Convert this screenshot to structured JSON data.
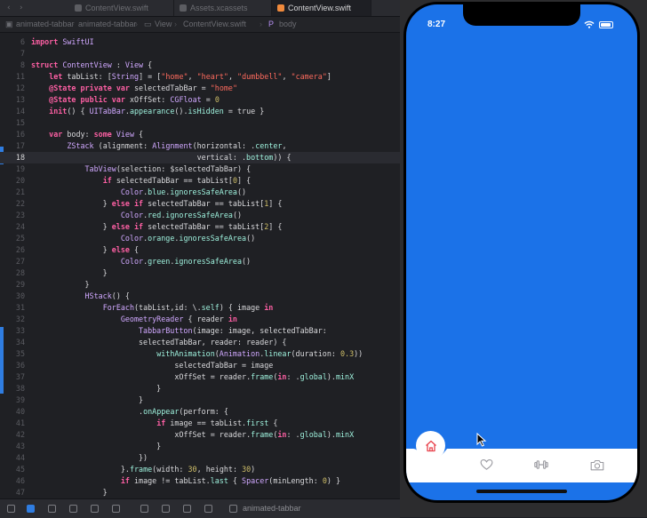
{
  "tabs": [
    {
      "label": "ContentView.swift",
      "active": false
    },
    {
      "label": "Assets.xcassets",
      "active": false
    },
    {
      "label": "ContentView.swift",
      "active": true
    }
  ],
  "breadcrumbs": [
    "animated-tabbar",
    "animated-tabbar",
    "View",
    "ContentView.swift",
    "body"
  ],
  "code_lines": [
    {
      "n": "6",
      "text": "import SwiftUI"
    },
    {
      "n": "7",
      "text": ""
    },
    {
      "n": "8",
      "text": "struct ContentView : View {"
    },
    {
      "n": "11",
      "text": "    let tabList: [String] = [\"home\", \"heart\", \"dumbbell\", \"camera\"]"
    },
    {
      "n": "12",
      "text": "    @State private var selectedTabBar = \"home\""
    },
    {
      "n": "13",
      "text": "    @State public var xOffSet: CGFloat = 0"
    },
    {
      "n": "14",
      "text": "    init() { UITabBar.appearance().isHidden = true }"
    },
    {
      "n": "15",
      "text": ""
    },
    {
      "n": "16",
      "text": "    var body: some View {"
    },
    {
      "n": "17",
      "text": "        ZStack (alignment: Alignment(horizontal: .center,"
    },
    {
      "n": "18",
      "text": "                                     vertical: .bottom)) {"
    },
    {
      "n": "19",
      "text": "            TabView(selection: $selectedTabBar) {"
    },
    {
      "n": "20",
      "text": "                if selectedTabBar == tabList[0] {"
    },
    {
      "n": "21",
      "text": "                    Color.blue.ignoresSafeArea()"
    },
    {
      "n": "22",
      "text": "                } else if selectedTabBar == tabList[1] {"
    },
    {
      "n": "23",
      "text": "                    Color.red.ignoresSafeArea()"
    },
    {
      "n": "24",
      "text": "                } else if selectedTabBar == tabList[2] {"
    },
    {
      "n": "25",
      "text": "                    Color.orange.ignoresSafeArea()"
    },
    {
      "n": "26",
      "text": "                } else {"
    },
    {
      "n": "27",
      "text": "                    Color.green.ignoresSafeArea()"
    },
    {
      "n": "28",
      "text": "                }"
    },
    {
      "n": "29",
      "text": "            }"
    },
    {
      "n": "30",
      "text": "            HStack() {"
    },
    {
      "n": "31",
      "text": "                ForEach(tabList,id: \\.self) { image in"
    },
    {
      "n": "32",
      "text": "                    GeometryReader { reader in"
    },
    {
      "n": "33",
      "text": "                        TabbarButton(image: image, selectedTabBar:"
    },
    {
      "n": "34",
      "text": "                        selectedTabBar, reader: reader) {"
    },
    {
      "n": "35",
      "text": "                            withAnimation(Animation.linear(duration: 0.3))"
    },
    {
      "n": "36",
      "text": "                                selectedTabBar = image"
    },
    {
      "n": "37",
      "text": "                                xOffSet = reader.frame(in: .global).minX"
    },
    {
      "n": "38",
      "text": "                            }"
    },
    {
      "n": "39",
      "text": "                        }"
    },
    {
      "n": "40",
      "text": "                        .onAppear(perform: {"
    },
    {
      "n": "41",
      "text": "                            if image == tabList.first {"
    },
    {
      "n": "42",
      "text": "                                xOffSet = reader.frame(in: .global).minX"
    },
    {
      "n": "43",
      "text": "                            }"
    },
    {
      "n": "44",
      "text": "                        })"
    },
    {
      "n": "45",
      "text": "                    }.frame(width: 30, height: 30)"
    },
    {
      "n": "46",
      "text": "                    if image != tabList.last { Spacer(minLength: 0) }"
    },
    {
      "n": "47",
      "text": "                }"
    }
  ],
  "highlighted_line": "18",
  "statusbar": {
    "scheme": "animated-tabbar"
  },
  "simulator": {
    "time": "8:27",
    "selected_tab": "home",
    "tab_icons": [
      "home-icon",
      "heart-icon",
      "dumbbell-icon",
      "camera-icon"
    ],
    "colors": {
      "background": "#1b72e8",
      "selected_icon": "#e8414b",
      "icon": "#9a9aa0"
    }
  }
}
